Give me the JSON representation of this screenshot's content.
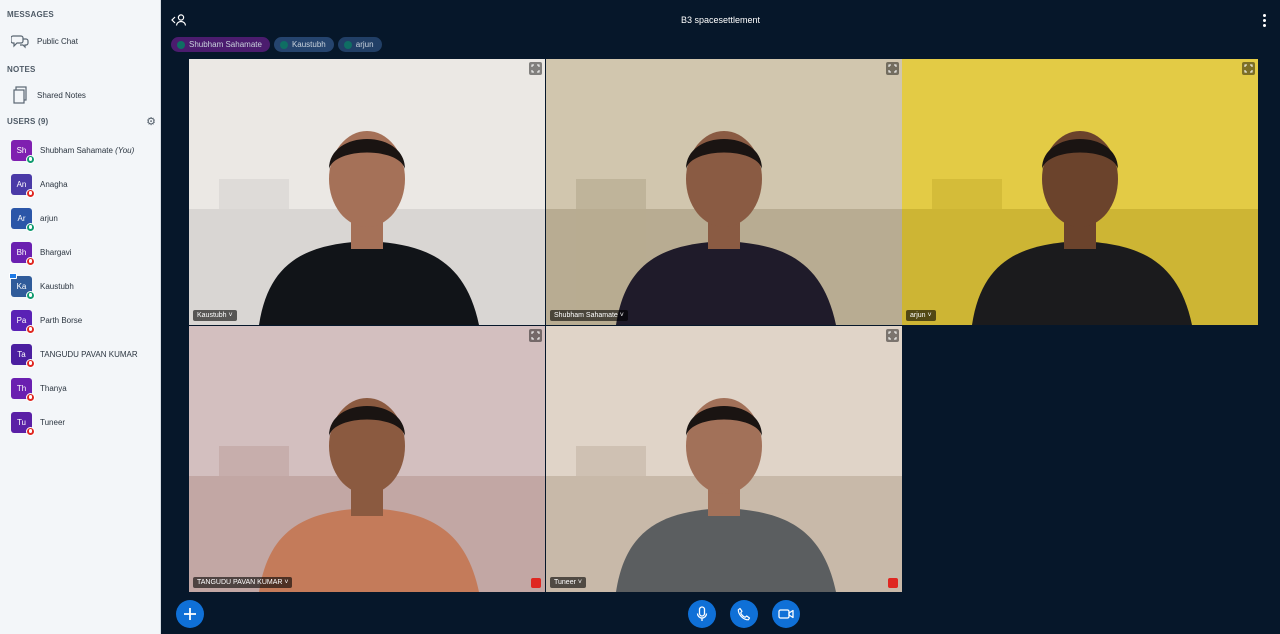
{
  "sidebar": {
    "messages_title": "MESSAGES",
    "public_chat": {
      "label": "Public Chat",
      "icon": "chat-bubbles-icon"
    },
    "notes_title": "NOTES",
    "shared_notes": {
      "label": "Shared Notes",
      "icon": "notes-icon"
    },
    "users_title": "USERS (9)",
    "users": [
      {
        "initials": "Sh",
        "name": "Shubham Sahamate",
        "suffix": "(You)",
        "color": "#7f1fb0",
        "mic": "on",
        "presenter": false
      },
      {
        "initials": "An",
        "name": "Anagha",
        "suffix": "",
        "color": "#4a3aa7",
        "mic": "off",
        "presenter": false
      },
      {
        "initials": "Ar",
        "name": "arjun",
        "suffix": "",
        "color": "#2b56a8",
        "mic": "on",
        "presenter": false
      },
      {
        "initials": "Bh",
        "name": "Bhargavi",
        "suffix": "",
        "color": "#6a1fb0",
        "mic": "off",
        "presenter": false
      },
      {
        "initials": "Ka",
        "name": "Kaustubh",
        "suffix": "",
        "color": "#2f5b9a",
        "mic": "on",
        "presenter": true
      },
      {
        "initials": "Pa",
        "name": "Parth Borse",
        "suffix": "",
        "color": "#5a22b5",
        "mic": "off",
        "presenter": false
      },
      {
        "initials": "Ta",
        "name": "TANGUDU PAVAN KUMAR",
        "suffix": "",
        "color": "#4b1fa0",
        "mic": "off",
        "presenter": false
      },
      {
        "initials": "Th",
        "name": "Thanya",
        "suffix": "",
        "color": "#6a1fb0",
        "mic": "off",
        "presenter": false
      },
      {
        "initials": "Tu",
        "name": "Tuneer",
        "suffix": "",
        "color": "#5a1fa6",
        "mic": "off",
        "presenter": false
      }
    ]
  },
  "header": {
    "title": "B3 spacesettlement"
  },
  "talkers": [
    {
      "name": "Shubham Sahamate",
      "color": "#4b1c6e"
    },
    {
      "name": "Kaustubh",
      "color": "#25446e"
    },
    {
      "name": "arjun",
      "color": "#213f66"
    }
  ],
  "videos": [
    {
      "name": "Kaustubh",
      "muted": false,
      "bg": "#d9d6d3",
      "wall": "#efece8",
      "shirt": "#111418",
      "skin": "#a57158"
    },
    {
      "name": "Shubham Sahamate",
      "muted": false,
      "bg": "#b8ac92",
      "wall": "#d7cdb5",
      "shirt": "#1f1b2a",
      "skin": "#8a5b43"
    },
    {
      "name": "arjun",
      "muted": false,
      "bg": "#cdb534",
      "wall": "#e8d14a",
      "shirt": "#1b1b1d",
      "skin": "#6b432c"
    },
    {
      "name": "TANGUDU PAVAN KUMAR",
      "muted": true,
      "bg": "#c2a7a4",
      "wall": "#d7c6c6",
      "shirt": "#c47b5a",
      "skin": "#8b5a40"
    },
    {
      "name": "Tuneer",
      "muted": true,
      "bg": "#c8b9a9",
      "wall": "#e6dbcf",
      "shirt": "#5b5e60",
      "skin": "#a27159"
    }
  ],
  "bottom": {
    "actions_icon": "plus-icon",
    "mic_icon": "microphone-icon",
    "phone_icon": "phone-icon",
    "camera_icon": "video-camera-icon"
  }
}
